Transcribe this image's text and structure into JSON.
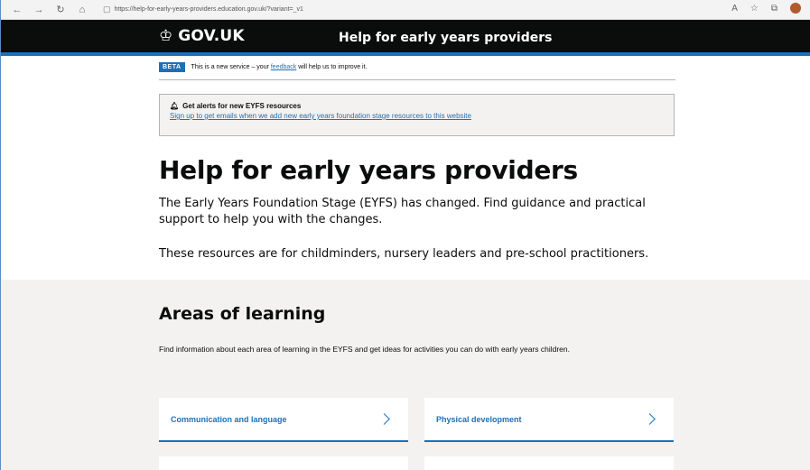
{
  "browser": {
    "url": "https://help-for-early-years-providers.education.gov.uk/?variant=_v1",
    "icons": [
      "back-icon",
      "forward-icon",
      "refresh-icon",
      "home-icon",
      "lock-icon",
      "read-aloud-icon",
      "favorites-icon",
      "collections-icon",
      "profile-avatar"
    ]
  },
  "header": {
    "logo_text": "GOV.UK",
    "service_name": "Help for early years providers"
  },
  "beta": {
    "tag": "BETA",
    "text_before": "This is a new service – your ",
    "link": "feedback",
    "text_after": " will help us to improve it."
  },
  "alert": {
    "title": "Get alerts for new EYFS resources",
    "link": "Sign up to get emails when we add new early years foundation stage resources to this website"
  },
  "main": {
    "title": "Help for early years providers",
    "intro": "The Early Years Foundation Stage (EYFS) has changed. Find guidance and practical support to help you with the changes.",
    "intro2": "These resources are for childminders, nursery leaders and pre-school practitioners."
  },
  "areas": {
    "title": "Areas of learning",
    "description": "Find information about each area of learning in the EYFS and get ideas for activities you can do with early years children.",
    "cards": [
      {
        "label": "Communication and language"
      },
      {
        "label": "Physical development"
      }
    ]
  },
  "colors": {
    "header_bg": "#0b0c0c",
    "brand_blue": "#1d70b8",
    "section_grey": "#f3f2f1"
  }
}
